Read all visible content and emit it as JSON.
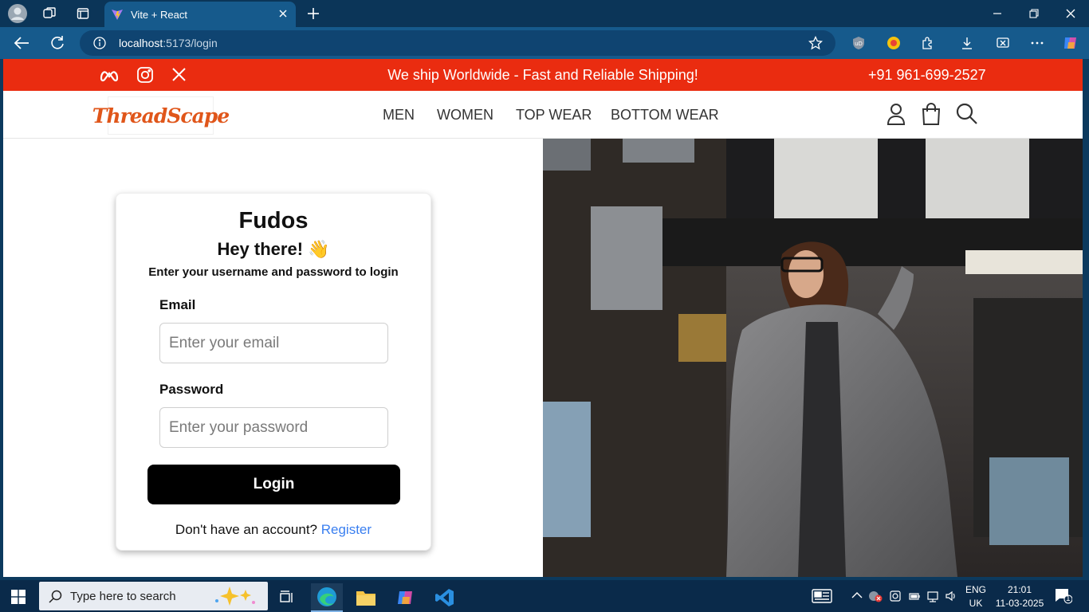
{
  "browser": {
    "tab_title": "Vite + React",
    "url_host": "localhost",
    "url_path": ":5173/login"
  },
  "promo": {
    "message": "We ship Worldwide - Fast and Reliable Shipping!",
    "phone": "+91 961-699-2527",
    "social_icons": [
      "meta-icon",
      "instagram-icon",
      "x-icon"
    ]
  },
  "header": {
    "logo_text": "ThreadScape",
    "nav": [
      "MEN",
      "WOMEN",
      "TOP WEAR",
      "BOTTOM WEAR"
    ],
    "icons": [
      "user-icon",
      "shopping-bag-icon",
      "search-icon"
    ]
  },
  "login": {
    "brand": "Fudos",
    "greeting": "Hey there! 👋",
    "subtitle": "Enter your username and password to login",
    "email_label": "Email",
    "email_placeholder": "Enter your email",
    "password_label": "Password",
    "password_placeholder": "Enter your password",
    "button_label": "Login",
    "register_prompt": "Don't have an account?",
    "register_link": "Register"
  },
  "taskbar": {
    "search_placeholder": "Type here to search",
    "language_top": "ENG",
    "language_bottom": "UK",
    "time": "21:01",
    "date": "11-03-2025",
    "notification_count": "1"
  },
  "colors": {
    "promo_bg": "#ea2c10",
    "login_button": "#000000",
    "link": "#3a7ff0",
    "logo": "#e0561a"
  }
}
